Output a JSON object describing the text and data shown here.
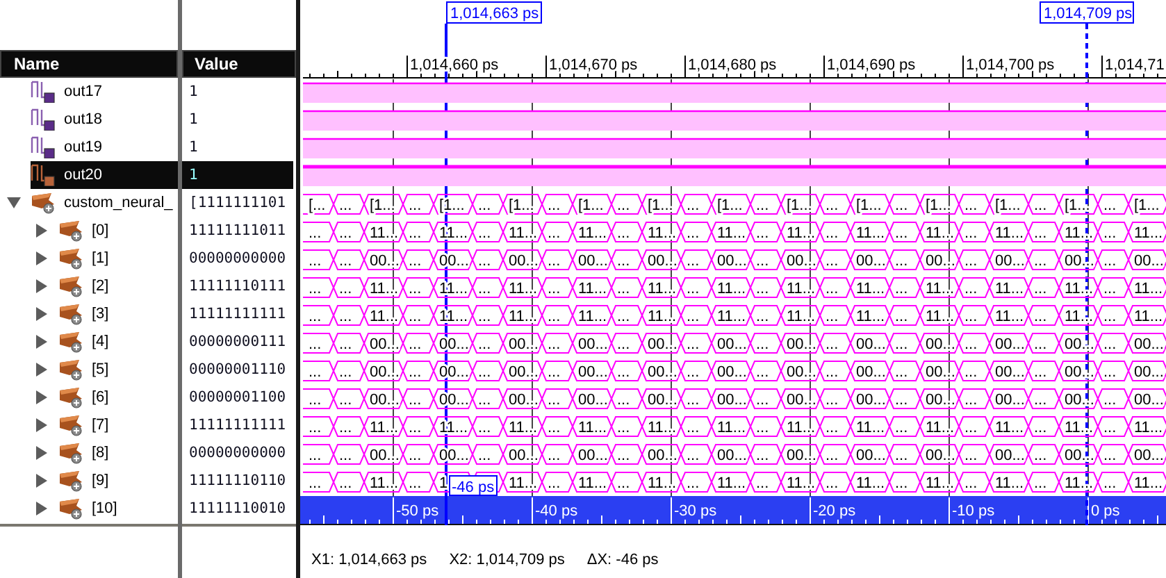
{
  "columns": {
    "name": "Name",
    "value": "Value"
  },
  "signals": [
    {
      "kind": "bit",
      "name": "out17",
      "value": "1",
      "selected": false
    },
    {
      "kind": "bit",
      "name": "out18",
      "value": "1",
      "selected": false
    },
    {
      "kind": "bit",
      "name": "out19",
      "value": "1",
      "selected": false
    },
    {
      "kind": "bit",
      "name": "out20",
      "value": "1",
      "selected": true
    },
    {
      "kind": "bus",
      "name": "custom_neural_",
      "value": "[1111111101",
      "selected": false,
      "expanded": true,
      "segments": [
        "[...",
        "...",
        "[1...",
        "...",
        "[1...",
        "...",
        "[1...",
        "...",
        "[1...",
        "...",
        "[1...",
        "...",
        "[1...",
        "...",
        "[1...",
        "...",
        "[1...",
        "...",
        "[1...",
        "...",
        "[1...",
        "...",
        "[1...",
        "...",
        "[1..."
      ],
      "children": [
        {
          "kind": "bus",
          "name": "[0]",
          "value": "11111111011",
          "selected": false,
          "expanded": false,
          "segments": [
            "...",
            "...",
            "11...",
            "...",
            "11...",
            "...",
            "11...",
            "...",
            "11...",
            "...",
            "11...",
            "...",
            "11...",
            "...",
            "11...",
            "...",
            "11...",
            "...",
            "11...",
            "...",
            "11...",
            "...",
            "11...",
            "...",
            "11..."
          ]
        },
        {
          "kind": "bus",
          "name": "[1]",
          "value": "00000000000",
          "selected": false,
          "expanded": false,
          "segments": [
            "...",
            "...",
            "00...",
            "...",
            "00...",
            "...",
            "00...",
            "...",
            "00...",
            "...",
            "00...",
            "...",
            "00...",
            "...",
            "00...",
            "...",
            "00...",
            "...",
            "00...",
            "...",
            "00...",
            "...",
            "00...",
            "...",
            "00..."
          ]
        },
        {
          "kind": "bus",
          "name": "[2]",
          "value": "11111110111",
          "selected": false,
          "expanded": false,
          "segments": [
            "...",
            "...",
            "11...",
            "...",
            "11...",
            "...",
            "11...",
            "...",
            "11...",
            "...",
            "11...",
            "...",
            "11...",
            "...",
            "11...",
            "...",
            "11...",
            "...",
            "11...",
            "...",
            "11...",
            "...",
            "11...",
            "...",
            "11..."
          ]
        },
        {
          "kind": "bus",
          "name": "[3]",
          "value": "11111111111",
          "selected": false,
          "expanded": false,
          "segments": [
            "...",
            "...",
            "11...",
            "...",
            "11...",
            "...",
            "11...",
            "...",
            "11...",
            "...",
            "11...",
            "...",
            "11...",
            "...",
            "11...",
            "...",
            "11...",
            "...",
            "11...",
            "...",
            "11...",
            "...",
            "11...",
            "...",
            "11..."
          ]
        },
        {
          "kind": "bus",
          "name": "[4]",
          "value": "00000000111",
          "selected": false,
          "expanded": false,
          "segments": [
            "...",
            "...",
            "00...",
            "...",
            "00...",
            "...",
            "00...",
            "...",
            "00...",
            "...",
            "00...",
            "...",
            "00...",
            "...",
            "00...",
            "...",
            "00...",
            "...",
            "00...",
            "...",
            "00...",
            "...",
            "00...",
            "...",
            "00..."
          ]
        },
        {
          "kind": "bus",
          "name": "[5]",
          "value": "00000001110",
          "selected": false,
          "expanded": false,
          "segments": [
            "...",
            "...",
            "00...",
            "...",
            "00...",
            "...",
            "00...",
            "...",
            "00...",
            "...",
            "00...",
            "...",
            "00...",
            "...",
            "00...",
            "...",
            "00...",
            "...",
            "00...",
            "...",
            "00...",
            "...",
            "00...",
            "...",
            "00..."
          ]
        },
        {
          "kind": "bus",
          "name": "[6]",
          "value": "00000001100",
          "selected": false,
          "expanded": false,
          "segments": [
            "...",
            "...",
            "00...",
            "...",
            "00...",
            "...",
            "00...",
            "...",
            "00...",
            "...",
            "00...",
            "...",
            "00...",
            "...",
            "00...",
            "...",
            "00...",
            "...",
            "00...",
            "...",
            "00...",
            "...",
            "00...",
            "...",
            "00..."
          ]
        },
        {
          "kind": "bus",
          "name": "[7]",
          "value": "11111111111",
          "selected": false,
          "expanded": false,
          "segments": [
            "...",
            "...",
            "11...",
            "...",
            "11...",
            "...",
            "11...",
            "...",
            "11...",
            "...",
            "11...",
            "...",
            "11...",
            "...",
            "11...",
            "...",
            "11...",
            "...",
            "11...",
            "...",
            "11...",
            "...",
            "11...",
            "...",
            "11..."
          ]
        },
        {
          "kind": "bus",
          "name": "[8]",
          "value": "00000000000",
          "selected": false,
          "expanded": false,
          "segments": [
            "...",
            "...",
            "00...",
            "...",
            "00...",
            "...",
            "00...",
            "...",
            "00...",
            "...",
            "00...",
            "...",
            "00...",
            "...",
            "00...",
            "...",
            "00...",
            "...",
            "00...",
            "...",
            "00...",
            "...",
            "00...",
            "...",
            "00..."
          ]
        },
        {
          "kind": "bus",
          "name": "[9]",
          "value": "11111110110",
          "selected": false,
          "expanded": false,
          "segments": [
            "...",
            "...",
            "11...",
            "...",
            "1",
            "11...",
            "...",
            "11...",
            "...",
            "11...",
            "...",
            "11...",
            "...",
            "11...",
            "...",
            "11...",
            "...",
            "11...",
            "...",
            "11...",
            "...",
            "11...",
            "...",
            "11..."
          ]
        },
        {
          "kind": "bus",
          "name": "[10]",
          "value": "11111110010",
          "selected": false,
          "expanded": false
        }
      ]
    }
  ],
  "cursors": [
    {
      "label": "1,014,663 ps"
    },
    {
      "label": "1,014,709 ps"
    }
  ],
  "time_ruler": [
    "1,014,660 ps",
    "1,014,670 ps",
    "1,014,680 ps",
    "1,014,690 ps",
    "1,014,700 ps",
    "1,014,71"
  ],
  "delta_ruler": [
    "-50 ps",
    "-40 ps",
    "-30 ps",
    "-20 ps",
    "-10 ps",
    "0 ps"
  ],
  "delta_label": "-46 ps",
  "status_bar": [
    "X1: 1,014,663 ps",
    "X2: 1,014,709 ps",
    "ΔX: -46 ps"
  ]
}
